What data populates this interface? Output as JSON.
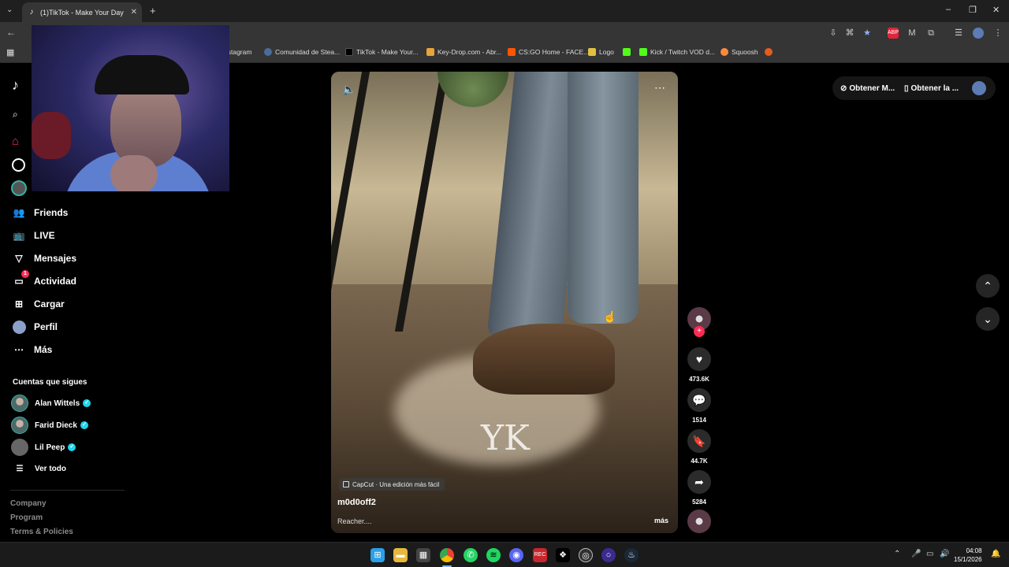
{
  "browser": {
    "tab_title": "(1)TikTok - Make Your Day",
    "tab_favicon": "tiktok-icon",
    "bookmarks": [
      {
        "label": "nstagram",
        "color": "#c13584"
      },
      {
        "label": "Comunidad de Stea...",
        "color": "#1b2838"
      },
      {
        "label": "TikTok - Make Your...",
        "color": "#000000"
      },
      {
        "label": "Key-Drop.com - Abr...",
        "color": "#e8a33a"
      },
      {
        "label": "CS:GO Home - FACE...",
        "color": "#ff5500"
      },
      {
        "label": "Logo",
        "color": "#e0c040"
      },
      {
        "label": "",
        "color": "#53fc18"
      },
      {
        "label": "Kick / Twitch VOD d...",
        "color": "#53fc18"
      },
      {
        "label": "Squoosh",
        "color": "#ff8a3d"
      }
    ]
  },
  "sidebar": {
    "nav": [
      {
        "label": "Friends",
        "icon": "friends-icon"
      },
      {
        "label": "LIVE",
        "icon": "live-icon"
      },
      {
        "label": "Mensajes",
        "icon": "messages-icon"
      },
      {
        "label": "Actividad",
        "icon": "activity-icon",
        "badge": "1"
      },
      {
        "label": "Cargar",
        "icon": "upload-icon"
      },
      {
        "label": "Perfil",
        "icon": "profile-icon"
      },
      {
        "label": "Más",
        "icon": "more-icon"
      }
    ],
    "following_title": "Cuentas que sigues",
    "following": [
      {
        "name": "Alan Wittels"
      },
      {
        "name": "Farid Dieck"
      },
      {
        "name": "Lil Peep"
      }
    ],
    "see_all": "Ver todo",
    "footer": [
      "Company",
      "Program",
      "Terms & Policies"
    ]
  },
  "topright": {
    "btn1": "Obtener M...",
    "btn2": "Obtener la ..."
  },
  "video": {
    "capcut_label": "CapCut · Una edición más fácil",
    "author": "m0d0off2",
    "caption": "Reacher....",
    "more": "más",
    "watermark": "YK"
  },
  "actions": {
    "likes": "473.6K",
    "comments": "1514",
    "saves": "44.7K",
    "shares": "5284"
  },
  "taskbar": {
    "time": "04:08",
    "date": "15/1/2026"
  },
  "colors": {
    "accent": "#fe2c55",
    "verified": "#20d5ec"
  }
}
